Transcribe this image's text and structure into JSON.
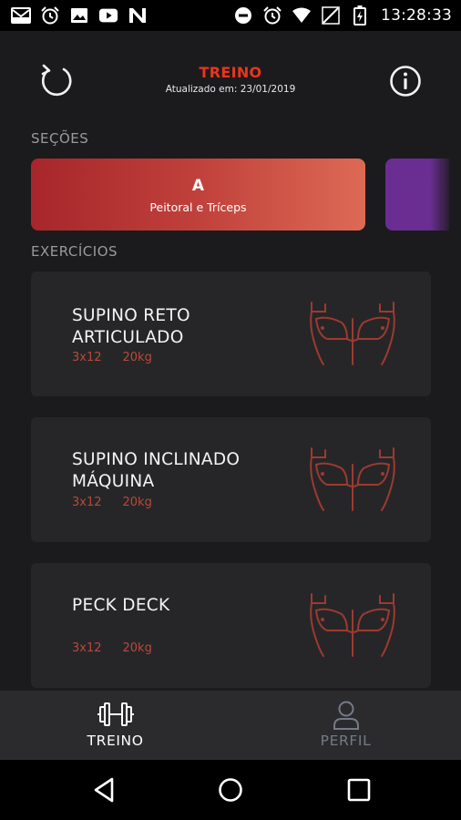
{
  "status_bar": {
    "time": "13:28:33",
    "left_icons": [
      "mail-icon",
      "alarm-icon",
      "image-icon",
      "youtube-icon",
      "n-app-icon"
    ],
    "right_icons": [
      "dnd-icon",
      "alarm-icon",
      "wifi-icon",
      "no-signal-icon",
      "battery-charging-icon"
    ]
  },
  "header": {
    "title": "TREINO",
    "updated": "Atualizado em: 23/01/2019",
    "refresh_icon": "refresh-icon",
    "info_icon": "info-icon"
  },
  "sections": {
    "label": "SEÇÕES",
    "items": [
      {
        "letter": "A",
        "name": "Peitoral e Tríceps",
        "color": "#b8353a"
      },
      {
        "letter": "",
        "name": "",
        "color": "#6a2e92"
      }
    ]
  },
  "exercises": {
    "label": "EXERCÍCIOS",
    "items": [
      {
        "name": "SUPINO RETO ARTICULADO",
        "sets": "3x12",
        "weight": "20kg"
      },
      {
        "name": "SUPINO INCLINADO MÁQUINA",
        "sets": "3x12",
        "weight": "20kg"
      },
      {
        "name": "PECK DECK",
        "sets": "3x12",
        "weight": "20kg"
      }
    ]
  },
  "bottom_nav": {
    "items": [
      {
        "label": "TREINO",
        "icon": "dumbbell-icon",
        "active": true
      },
      {
        "label": "PERFIL",
        "icon": "user-icon",
        "active": false
      }
    ]
  },
  "android_nav": [
    "back-icon",
    "home-icon",
    "recents-icon"
  ],
  "colors": {
    "accent": "#e8351e",
    "background": "#1b1b1d",
    "card": "#262628",
    "muscle_stroke": "#9c3a30",
    "meta": "#b84a3a"
  }
}
